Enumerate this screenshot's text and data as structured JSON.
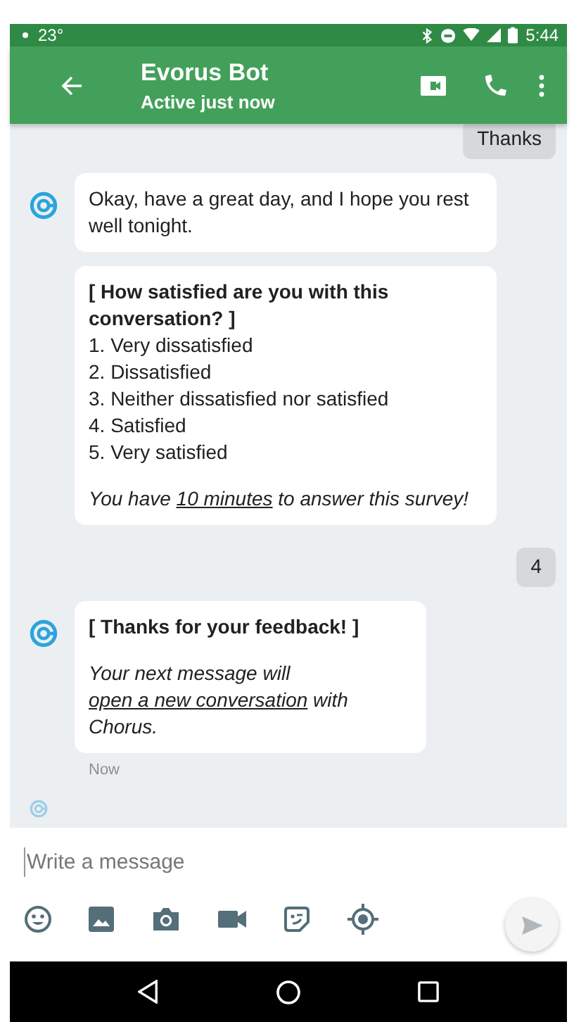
{
  "status_bar": {
    "temperature": "23°",
    "time": "5:44"
  },
  "header": {
    "title": "Evorus Bot",
    "subtitle": "Active just now"
  },
  "messages": [
    {
      "kind": "outgoing",
      "text": "Thanks"
    },
    {
      "kind": "incoming",
      "bubbles": [
        {
          "kind": "text",
          "text": "Okay, have a great day, and I hope you rest well tonight."
        },
        {
          "kind": "survey",
          "title": "[ How satisfied are you with this conversation? ]",
          "options": [
            "1. Very dissatisfied",
            "2. Dissatisfied",
            "3. Neither dissatisfied nor satisfied",
            "4. Satisfied",
            "5. Very satisfied"
          ],
          "note": {
            "before": "You have ",
            "link": "10 minutes",
            "after": " to answer this survey!"
          }
        }
      ]
    },
    {
      "kind": "outgoing",
      "text": "4"
    },
    {
      "kind": "incoming",
      "bubbles": [
        {
          "kind": "feedback",
          "title": "[ Thanks for your feedback! ]",
          "note": {
            "before": "Your next message will ",
            "link": "open a new conversation",
            "after": " with Chorus."
          }
        }
      ],
      "time": "Now"
    }
  ],
  "composer": {
    "placeholder": "Write a message"
  }
}
